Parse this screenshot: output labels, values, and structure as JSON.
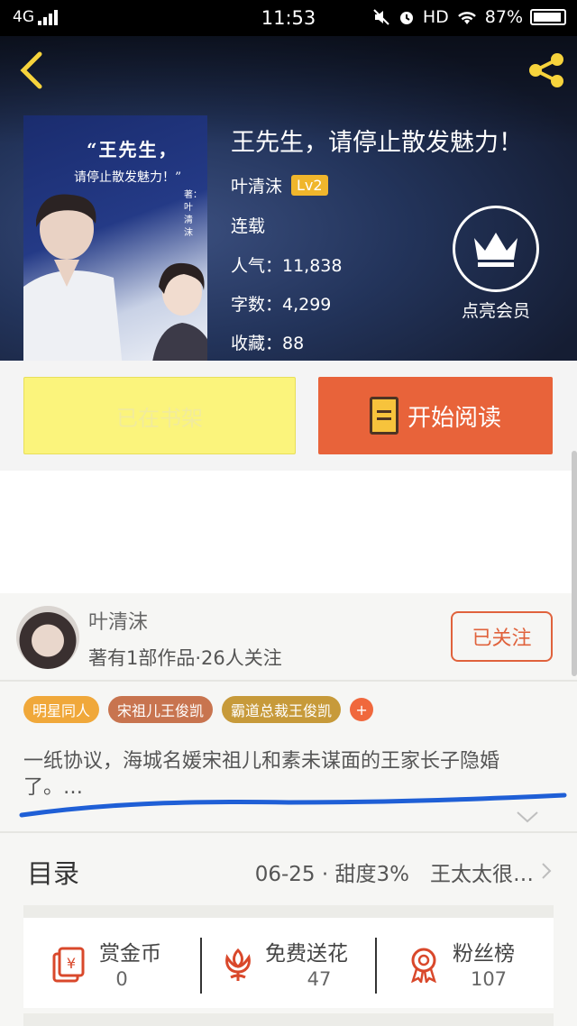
{
  "status_bar": {
    "network": "4G",
    "time": "11:53",
    "hd": "HD",
    "battery": "87%"
  },
  "book": {
    "title": "王先生，请停止散发魅力！",
    "author": "叶清沫",
    "level": "Lv2",
    "status": "连载",
    "popularity": "人气：11,838",
    "word_count": "字数：4,299",
    "favorites": "收藏：88",
    "cover": {
      "title": "“王先生，",
      "subtitle": "请停止散发魅力！”",
      "author": "著：叶清沫"
    }
  },
  "vip": {
    "label": "点亮会员"
  },
  "actions": {
    "shelf_label": "已在书架",
    "read_label": "开始阅读"
  },
  "author_card": {
    "name": "叶清沫",
    "works": "著有1部作品·26人关注",
    "follow_label": "已关注"
  },
  "tags": [
    {
      "label": "明星同人",
      "color": "#f0a83a"
    },
    {
      "label": "宋祖儿王俊凯",
      "color": "#c8744f"
    },
    {
      "label": "霸道总裁王俊凯",
      "color": "#c79a3a"
    }
  ],
  "tag_more": "+",
  "intro": "一纸协议，海城名媛宋祖儿和素未谋面的王家长子隐婚了。…",
  "toc": {
    "label": "目录",
    "latest": "06-25 · 甜度3%　王太太很…"
  },
  "stats": [
    {
      "label": "赏金币",
      "value": "0",
      "icon": "coin-envelope-icon"
    },
    {
      "label": "免费送花",
      "value": "47",
      "icon": "flower-icon"
    },
    {
      "label": "粉丝榜",
      "value": "107",
      "icon": "ribbon-medal-icon"
    }
  ],
  "colors": {
    "accent": "#e8633a",
    "shelf_button": "#fbf47c",
    "header": "#23345b",
    "underline": "#1f5fd6"
  }
}
